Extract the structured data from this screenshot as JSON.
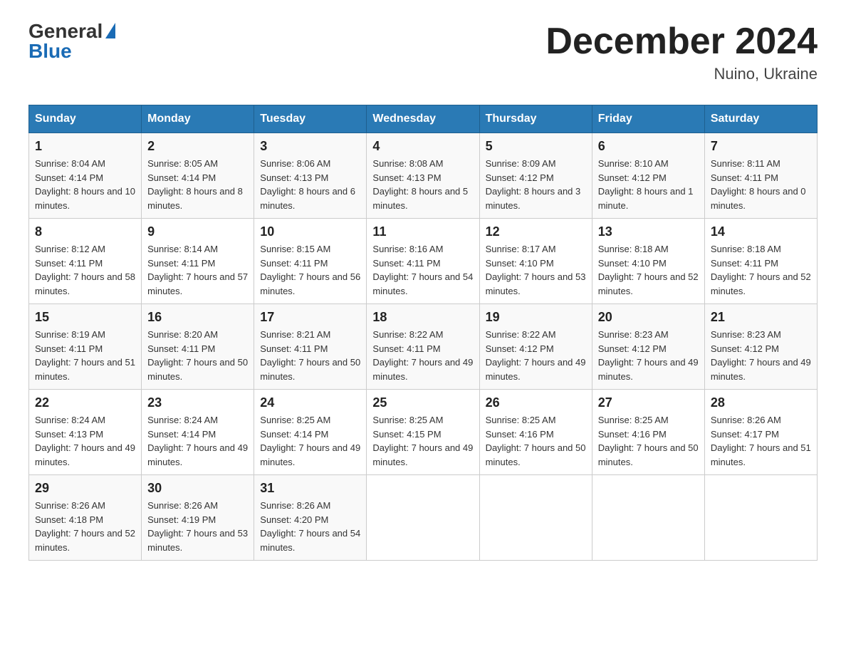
{
  "logo": {
    "general": "General",
    "blue": "Blue"
  },
  "title": "December 2024",
  "subtitle": "Nuino, Ukraine",
  "weekdays": [
    "Sunday",
    "Monday",
    "Tuesday",
    "Wednesday",
    "Thursday",
    "Friday",
    "Saturday"
  ],
  "weeks": [
    [
      {
        "day": "1",
        "sunrise": "8:04 AM",
        "sunset": "4:14 PM",
        "daylight": "8 hours and 10 minutes."
      },
      {
        "day": "2",
        "sunrise": "8:05 AM",
        "sunset": "4:14 PM",
        "daylight": "8 hours and 8 minutes."
      },
      {
        "day": "3",
        "sunrise": "8:06 AM",
        "sunset": "4:13 PM",
        "daylight": "8 hours and 6 minutes."
      },
      {
        "day": "4",
        "sunrise": "8:08 AM",
        "sunset": "4:13 PM",
        "daylight": "8 hours and 5 minutes."
      },
      {
        "day": "5",
        "sunrise": "8:09 AM",
        "sunset": "4:12 PM",
        "daylight": "8 hours and 3 minutes."
      },
      {
        "day": "6",
        "sunrise": "8:10 AM",
        "sunset": "4:12 PM",
        "daylight": "8 hours and 1 minute."
      },
      {
        "day": "7",
        "sunrise": "8:11 AM",
        "sunset": "4:11 PM",
        "daylight": "8 hours and 0 minutes."
      }
    ],
    [
      {
        "day": "8",
        "sunrise": "8:12 AM",
        "sunset": "4:11 PM",
        "daylight": "7 hours and 58 minutes."
      },
      {
        "day": "9",
        "sunrise": "8:14 AM",
        "sunset": "4:11 PM",
        "daylight": "7 hours and 57 minutes."
      },
      {
        "day": "10",
        "sunrise": "8:15 AM",
        "sunset": "4:11 PM",
        "daylight": "7 hours and 56 minutes."
      },
      {
        "day": "11",
        "sunrise": "8:16 AM",
        "sunset": "4:11 PM",
        "daylight": "7 hours and 54 minutes."
      },
      {
        "day": "12",
        "sunrise": "8:17 AM",
        "sunset": "4:10 PM",
        "daylight": "7 hours and 53 minutes."
      },
      {
        "day": "13",
        "sunrise": "8:18 AM",
        "sunset": "4:10 PM",
        "daylight": "7 hours and 52 minutes."
      },
      {
        "day": "14",
        "sunrise": "8:18 AM",
        "sunset": "4:11 PM",
        "daylight": "7 hours and 52 minutes."
      }
    ],
    [
      {
        "day": "15",
        "sunrise": "8:19 AM",
        "sunset": "4:11 PM",
        "daylight": "7 hours and 51 minutes."
      },
      {
        "day": "16",
        "sunrise": "8:20 AM",
        "sunset": "4:11 PM",
        "daylight": "7 hours and 50 minutes."
      },
      {
        "day": "17",
        "sunrise": "8:21 AM",
        "sunset": "4:11 PM",
        "daylight": "7 hours and 50 minutes."
      },
      {
        "day": "18",
        "sunrise": "8:22 AM",
        "sunset": "4:11 PM",
        "daylight": "7 hours and 49 minutes."
      },
      {
        "day": "19",
        "sunrise": "8:22 AM",
        "sunset": "4:12 PM",
        "daylight": "7 hours and 49 minutes."
      },
      {
        "day": "20",
        "sunrise": "8:23 AM",
        "sunset": "4:12 PM",
        "daylight": "7 hours and 49 minutes."
      },
      {
        "day": "21",
        "sunrise": "8:23 AM",
        "sunset": "4:12 PM",
        "daylight": "7 hours and 49 minutes."
      }
    ],
    [
      {
        "day": "22",
        "sunrise": "8:24 AM",
        "sunset": "4:13 PM",
        "daylight": "7 hours and 49 minutes."
      },
      {
        "day": "23",
        "sunrise": "8:24 AM",
        "sunset": "4:14 PM",
        "daylight": "7 hours and 49 minutes."
      },
      {
        "day": "24",
        "sunrise": "8:25 AM",
        "sunset": "4:14 PM",
        "daylight": "7 hours and 49 minutes."
      },
      {
        "day": "25",
        "sunrise": "8:25 AM",
        "sunset": "4:15 PM",
        "daylight": "7 hours and 49 minutes."
      },
      {
        "day": "26",
        "sunrise": "8:25 AM",
        "sunset": "4:16 PM",
        "daylight": "7 hours and 50 minutes."
      },
      {
        "day": "27",
        "sunrise": "8:25 AM",
        "sunset": "4:16 PM",
        "daylight": "7 hours and 50 minutes."
      },
      {
        "day": "28",
        "sunrise": "8:26 AM",
        "sunset": "4:17 PM",
        "daylight": "7 hours and 51 minutes."
      }
    ],
    [
      {
        "day": "29",
        "sunrise": "8:26 AM",
        "sunset": "4:18 PM",
        "daylight": "7 hours and 52 minutes."
      },
      {
        "day": "30",
        "sunrise": "8:26 AM",
        "sunset": "4:19 PM",
        "daylight": "7 hours and 53 minutes."
      },
      {
        "day": "31",
        "sunrise": "8:26 AM",
        "sunset": "4:20 PM",
        "daylight": "7 hours and 54 minutes."
      },
      null,
      null,
      null,
      null
    ]
  ]
}
